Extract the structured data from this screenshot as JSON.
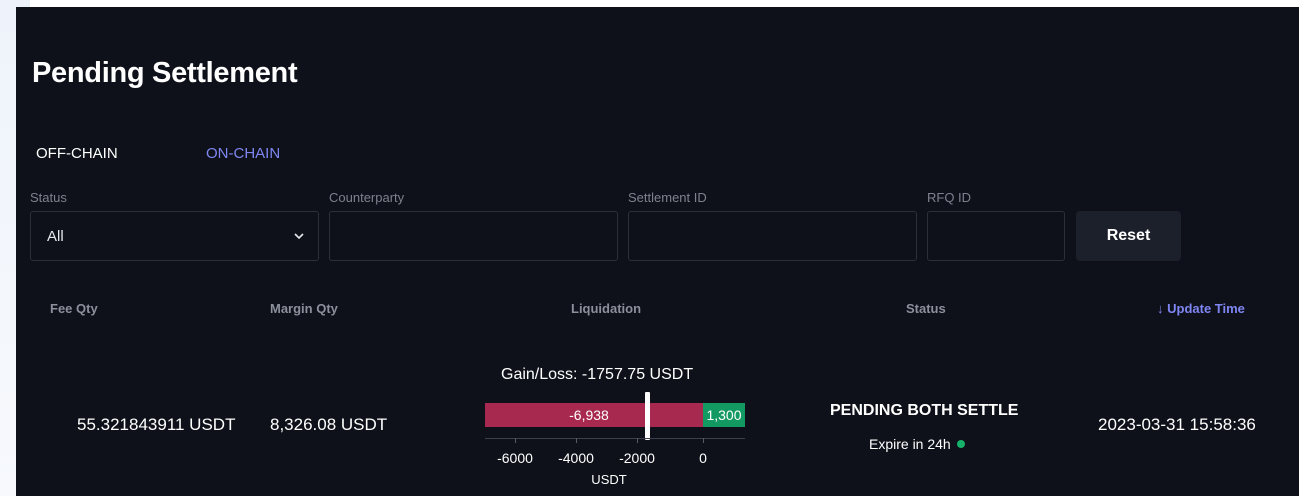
{
  "page": {
    "title": "Pending Settlement"
  },
  "tabs": [
    {
      "label": "OFF-CHAIN",
      "active": true
    },
    {
      "label": "ON-CHAIN",
      "active": false
    }
  ],
  "filters": {
    "status": {
      "label": "Status",
      "value": "All"
    },
    "counterparty": {
      "label": "Counterparty",
      "value": ""
    },
    "settlement_id": {
      "label": "Settlement ID",
      "value": ""
    },
    "rfq_id": {
      "label": "RFQ ID",
      "value": ""
    },
    "reset_label": "Reset"
  },
  "table": {
    "columns": [
      "Fee Qty",
      "Margin Qty",
      "Liquidation",
      "Status",
      "↓ Update Time"
    ],
    "rows": [
      {
        "fee_qty": "55.321843911 USDT",
        "margin_qty": "8,326.08 USDT",
        "liquidation": {
          "gain_loss_text": "Gain/Loss: -1757.75 USDT",
          "loss_label": "-6,938",
          "gain_label": "1,300",
          "loss_value": -6938,
          "gain_value": 1300,
          "marker_value": -1757.75,
          "axis_ticks": [
            "-6000",
            "-4000",
            "-2000",
            "0"
          ],
          "unit": "USDT"
        },
        "status": "PENDING BOTH SETTLE",
        "expire": "Expire in 24h",
        "update_time": "2023-03-31 15:58:36"
      }
    ]
  },
  "colors": {
    "background": "#0e1119",
    "accent": "#7f86f2",
    "loss": "#a8294f",
    "gain": "#129a62",
    "status_dot": "#17b26a"
  }
}
